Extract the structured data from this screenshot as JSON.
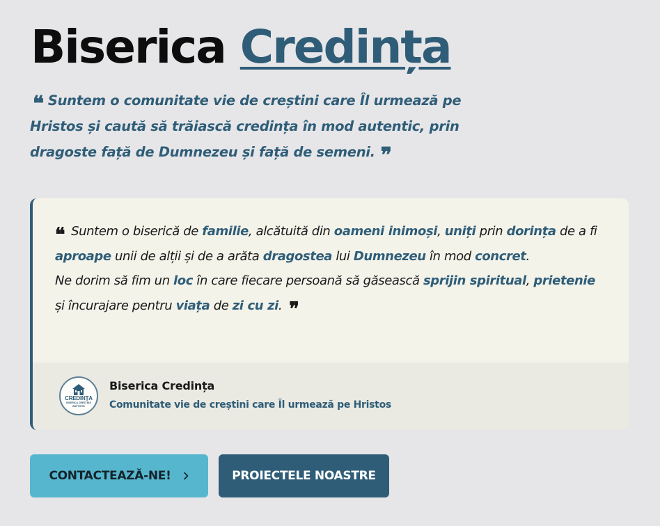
{
  "header": {
    "title_main": "Biserica",
    "title_accent": "Credința"
  },
  "tagline": {
    "text": "Suntem o comunitate vie de creștini care Îl urmează pe Hristos și caută să trăiască credința în mod autentic, prin dragoste față de Dumnezeu și față de semeni."
  },
  "quote_marks": {
    "open": "❝",
    "close": "❞"
  },
  "card": {
    "segments": [
      {
        "t": "Suntem o biserică de ",
        "h": false
      },
      {
        "t": "familie",
        "h": true
      },
      {
        "t": ", alcătuită din ",
        "h": false
      },
      {
        "t": "oameni inimoși",
        "h": true
      },
      {
        "t": ", ",
        "h": false
      },
      {
        "t": "uniți",
        "h": true
      },
      {
        "t": " prin ",
        "h": false
      },
      {
        "t": "dorința",
        "h": true
      },
      {
        "t": " de a fi ",
        "h": false
      },
      {
        "t": "aproape",
        "h": true
      },
      {
        "t": " unii de alții și de a arăta ",
        "h": false
      },
      {
        "t": "dragostea",
        "h": true
      },
      {
        "t": " lui ",
        "h": false
      },
      {
        "t": "Dumnezeu",
        "h": true
      },
      {
        "t": " în mod ",
        "h": false
      },
      {
        "t": "concret",
        "h": true
      },
      {
        "t": ".",
        "h": false
      },
      {
        "br": true
      },
      {
        "t": "Ne dorim să fim un ",
        "h": false
      },
      {
        "t": "loc",
        "h": true
      },
      {
        "t": " în care fiecare persoană să găsească ",
        "h": false
      },
      {
        "t": "sprijin spiritual",
        "h": true
      },
      {
        "t": ", ",
        "h": false
      },
      {
        "t": "prietenie",
        "h": true
      },
      {
        "t": " și încurajare pentru ",
        "h": false
      },
      {
        "t": "viața",
        "h": true
      },
      {
        "t": " de ",
        "h": false
      },
      {
        "t": "zi cu zi",
        "h": true
      },
      {
        "t": ".",
        "h": false
      }
    ],
    "footer": {
      "logo_text": "CREDINȚA",
      "logo_sub": "BISERICA CREȘTINĂ",
      "logo_sub2": "BAPTISTĂ",
      "org_name": "Biserica Credința",
      "org_subtitle": "Comunitate vie de creștini care Îl urmează pe Hristos"
    }
  },
  "buttons": {
    "contact_label": "CONTACTEAZĂ-NE!",
    "contact_icon": "chevron-right-icon",
    "projects_label": "PROIECTELE NOASTRE"
  },
  "colors": {
    "background": "#e6e6e8",
    "accent": "#2f5d78",
    "button_contact": "#56b6cd",
    "card_bg": "#f3f3ea",
    "card_footer_bg": "#eaeae2"
  }
}
